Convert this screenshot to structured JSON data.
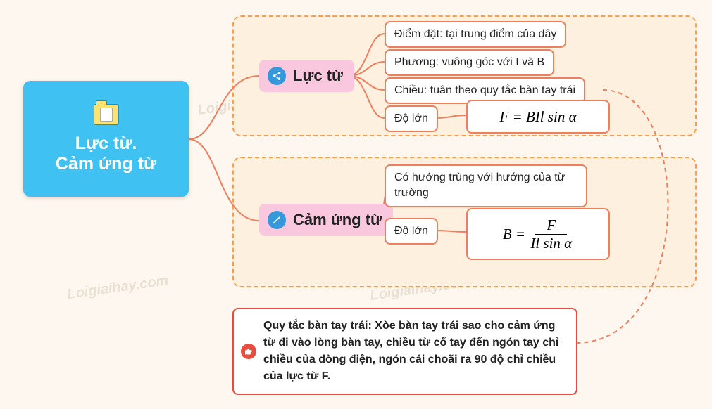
{
  "watermark": "Loigiaihay.com",
  "root": {
    "line1": "Lực từ.",
    "line2": "Cảm ứng từ"
  },
  "luc_tu": {
    "title": "Lực từ",
    "diem_dat": "Điểm đặt: tại trung điểm của dây",
    "phuong": "Phương: vuông góc với I và B",
    "chieu": "Chiều: tuân theo quy tắc bàn tay trái",
    "do_lon_label": "Độ lớn",
    "formula": "F = BIl sin α"
  },
  "cam_ung_tu": {
    "title": "Cảm ứng từ",
    "huong": "Có hướng trùng với hướng của từ trường",
    "do_lon_label": "Độ lớn",
    "formula_lhs": "B =",
    "formula_num": "F",
    "formula_den": "Il sin α"
  },
  "note": {
    "text": "Quy tắc bàn tay trái: Xòe bàn tay trái sao cho cảm ứng từ đi vào lòng bàn tay, chiều từ cổ tay đến ngón tay chỉ chiều của dòng điện, ngón cái choãi ra 90 độ chỉ chiều của lực từ F."
  }
}
